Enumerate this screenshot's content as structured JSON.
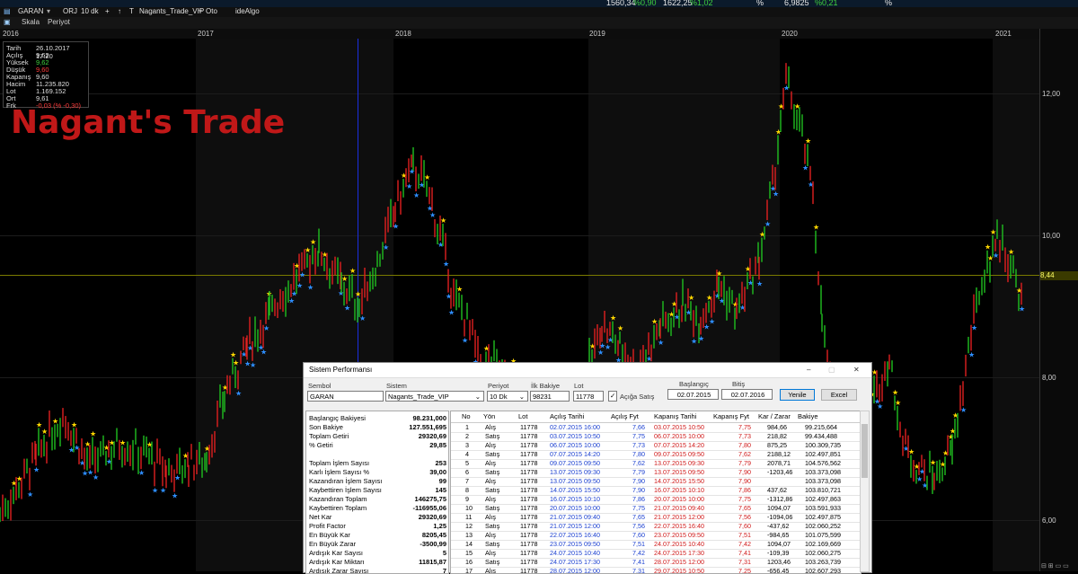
{
  "topbar": {
    "items": [
      "1560,34",
      "%0,90",
      "1622,25",
      "%1,02",
      "%",
      "6,9825",
      "%0,21",
      "%"
    ],
    "colors": {
      "up": "#3fd13f",
      "text": "#e8e8e8"
    }
  },
  "toolbar": {
    "symbol": "GARAN",
    "orj": "ORJ",
    "period": "10 dk",
    "system": "Nagants_Trade_VIP",
    "oto": "Oto",
    "idealgo": "ideAlgo"
  },
  "toolbar2": {
    "skala": "Skala",
    "periyot": "Periyot",
    "icons": [
      "arrow-left-icon",
      "arrow-right-icon",
      "shrink-icon",
      "expand-icon",
      "step-back-icon",
      "step-forward-icon",
      "cursor-icon",
      "crosshair-icon",
      "line-icon",
      "equal-icon",
      "zoom-out-icon",
      "zoom-in-icon",
      "zoom-fit-icon",
      "refresh-icon"
    ],
    "glyphs": [
      "◂",
      "▸",
      "▸◂",
      "◂▸",
      "◂|",
      "|▸",
      "↖",
      "⊹",
      "↗",
      "⇉",
      "⊖",
      "⊕",
      "⊙",
      "↺"
    ]
  },
  "years": [
    "2016",
    "2017",
    "2018",
    "2019",
    "2020",
    "2021"
  ],
  "yaxis": {
    "ticks": [
      "12,00",
      "10,00",
      "8,00",
      "6,00"
    ],
    "current": "8,44"
  },
  "info": {
    "rows": [
      {
        "k": "Tarih",
        "v": "26.10.2017 17:20"
      },
      {
        "k": "Açılış",
        "v": "9,62"
      },
      {
        "k": "Yüksek",
        "v": "9,62"
      },
      {
        "k": "Düşük",
        "v": "9,60"
      },
      {
        "k": "Kapanış",
        "v": "9,60"
      },
      {
        "k": "Hacim",
        "v": "11.235.820"
      },
      {
        "k": "Lot",
        "v": "1.169.152"
      },
      {
        "k": "Ort",
        "v": "9,61"
      },
      {
        "k": "Frk",
        "v": "-0,03 (% -0,30)"
      }
    ],
    "colors": {
      "Yüksek": "#3fd13f",
      "Düşük": "#ff3b3b",
      "Frk": "#ff3b3b"
    }
  },
  "watermark": "Nagant's Trade",
  "chart_data": {
    "type": "candlestick",
    "symbol": "GARAN",
    "x_range": [
      "2016",
      "2021"
    ],
    "ylim": [
      5.5,
      12.9
    ],
    "current_price": 8.44,
    "series_points": [
      [
        0,
        6.2
      ],
      [
        40,
        7.0
      ],
      [
        70,
        7.6
      ],
      [
        100,
        6.9
      ],
      [
        130,
        7.2
      ],
      [
        160,
        7.1
      ],
      [
        185,
        6.8
      ],
      [
        210,
        6.9
      ],
      [
        230,
        7.0
      ],
      [
        250,
        7.9
      ],
      [
        275,
        8.6
      ],
      [
        300,
        9.1
      ],
      [
        330,
        9.6
      ],
      [
        355,
        10.0
      ],
      [
        380,
        9.5
      ],
      [
        400,
        9.2
      ],
      [
        420,
        9.8
      ],
      [
        440,
        10.6
      ],
      [
        460,
        11.2
      ],
      [
        475,
        10.9
      ],
      [
        490,
        10.2
      ],
      [
        505,
        9.3
      ],
      [
        520,
        9.0
      ],
      [
        535,
        8.3
      ],
      [
        550,
        8.4
      ],
      [
        575,
        8.0
      ],
      [
        600,
        7.9
      ],
      [
        625,
        7.8
      ],
      [
        650,
        8.1
      ],
      [
        670,
        8.9
      ],
      [
        690,
        8.6
      ],
      [
        710,
        8.3
      ],
      [
        735,
        8.9
      ],
      [
        760,
        9.2
      ],
      [
        780,
        9.0
      ],
      [
        800,
        9.5
      ],
      [
        820,
        9.1
      ],
      [
        845,
        9.8
      ],
      [
        860,
        10.9
      ],
      [
        875,
        12.4
      ],
      [
        890,
        11.8
      ],
      [
        905,
        10.8
      ],
      [
        915,
        9.0
      ],
      [
        930,
        7.4
      ],
      [
        950,
        7.9
      ],
      [
        970,
        7.8
      ],
      [
        990,
        8.4
      ],
      [
        1005,
        7.2
      ],
      [
        1020,
        6.9
      ],
      [
        1040,
        6.7
      ],
      [
        1060,
        7.1
      ],
      [
        1075,
        8.3
      ],
      [
        1090,
        9.4
      ],
      [
        1110,
        10.2
      ],
      [
        1125,
        9.8
      ],
      [
        1140,
        9.1
      ]
    ]
  },
  "dialog": {
    "title": "Sistem Performansı",
    "labels": {
      "sembol": "Sembol",
      "sistem": "Sistem",
      "periyot": "Periyot",
      "ilk_bakiye": "İlk Bakiye",
      "lot": "Lot",
      "baslangic": "Başlangıç",
      "bitis": "Bitiş",
      "aciga_satis": "Açığa Satış"
    },
    "values": {
      "sembol": "GARAN",
      "sistem": "Nagants_Trade_VIP",
      "periyot": "10 Dk",
      "ilk_bakiye": "98231",
      "lot": "11778",
      "baslangic": "02.07.2015",
      "bitis": "02.07.2016"
    },
    "buttons": {
      "yenile": "Yenile",
      "excel": "Excel"
    },
    "stats": [
      {
        "k": "Başlangıç Bakiyesi",
        "v": "98.231,000"
      },
      {
        "k": "Son Bakiye",
        "v": "127.551,695"
      },
      {
        "k": "Toplam Getiri",
        "v": "29320,69"
      },
      {
        "k": "% Getiri",
        "v": "29,85"
      },
      {
        "k": "",
        "v": ""
      },
      {
        "k": "Toplam İşlem Sayısı",
        "v": "253"
      },
      {
        "k": "Karlı İşlem Sayısı %",
        "v": "39,00"
      },
      {
        "k": "Kazandıran İşlem Sayısı",
        "v": "99"
      },
      {
        "k": "Kaybettiren İşlem Sayısı",
        "v": "145"
      },
      {
        "k": "Kazandıran Toplam",
        "v": "146275,75"
      },
      {
        "k": "Kaybettiren Toplam",
        "v": "-116955,06"
      },
      {
        "k": "Net Kar",
        "v": "29320,69"
      },
      {
        "k": "Profit Factor",
        "v": "1,25"
      },
      {
        "k": "En Büyük Kar",
        "v": "8205,45"
      },
      {
        "k": "En Büyük Zarar",
        "v": "-3500,99"
      },
      {
        "k": "Ardışık Kar Sayısı",
        "v": "5"
      },
      {
        "k": "Ardışık Kar Miktarı",
        "v": "11815,87"
      },
      {
        "k": "Ardışık Zarar Sayısı",
        "v": "7"
      }
    ],
    "columns": [
      "No",
      "Yön",
      "Lot",
      "Açılış Tarihi",
      "Açılış Fyt",
      "Kapanış Tarihi",
      "Kapanış Fyt",
      "Kar / Zarar",
      "Bakiye"
    ],
    "trades": [
      {
        "no": "1",
        "yon": "Alış",
        "lot": "11778",
        "acilis_tarihi": "02.07.2015 16:00",
        "acilis_fyt": "7,66",
        "kapanis_tarihi": "03.07.2015 10:50",
        "kapanis_fyt": "7,75",
        "kar": "984,66",
        "bakiye": "99.215,664"
      },
      {
        "no": "2",
        "yon": "Satış",
        "lot": "11778",
        "acilis_tarihi": "03.07.2015 10:50",
        "acilis_fyt": "7,75",
        "kapanis_tarihi": "06.07.2015 10:00",
        "kapanis_fyt": "7,73",
        "kar": "218,82",
        "bakiye": "99.434,488"
      },
      {
        "no": "3",
        "yon": "Alış",
        "lot": "11778",
        "acilis_tarihi": "06.07.2015 10:00",
        "acilis_fyt": "7,73",
        "kapanis_tarihi": "07.07.2015 14:20",
        "kapanis_fyt": "7,80",
        "kar": "875,25",
        "bakiye": "100.309,735"
      },
      {
        "no": "4",
        "yon": "Satış",
        "lot": "11778",
        "acilis_tarihi": "07.07.2015 14:20",
        "acilis_fyt": "7,80",
        "kapanis_tarihi": "09.07.2015 09:50",
        "kapanis_fyt": "7,62",
        "kar": "2188,12",
        "bakiye": "102.497,851"
      },
      {
        "no": "5",
        "yon": "Alış",
        "lot": "11778",
        "acilis_tarihi": "09.07.2015 09:50",
        "acilis_fyt": "7,62",
        "kapanis_tarihi": "13.07.2015 09:30",
        "kapanis_fyt": "7,79",
        "kar": "2078,71",
        "bakiye": "104.576,562"
      },
      {
        "no": "6",
        "yon": "Satış",
        "lot": "11778",
        "acilis_tarihi": "13.07.2015 09:30",
        "acilis_fyt": "7,79",
        "kapanis_tarihi": "13.07.2015 09:50",
        "kapanis_fyt": "7,90",
        "kar": "-1203,46",
        "bakiye": "103.373,098"
      },
      {
        "no": "7",
        "yon": "Alış",
        "lot": "11778",
        "acilis_tarihi": "13.07.2015 09:50",
        "acilis_fyt": "7,90",
        "kapanis_tarihi": "14.07.2015 15:50",
        "kapanis_fyt": "7,90",
        "kar": "",
        "bakiye": "103.373,098"
      },
      {
        "no": "8",
        "yon": "Satış",
        "lot": "11778",
        "acilis_tarihi": "14.07.2015 15:50",
        "acilis_fyt": "7,90",
        "kapanis_tarihi": "16.07.2015 10:10",
        "kapanis_fyt": "7,86",
        "kar": "437,62",
        "bakiye": "103.810,721"
      },
      {
        "no": "9",
        "yon": "Alış",
        "lot": "11778",
        "acilis_tarihi": "16.07.2015 10:10",
        "acilis_fyt": "7,86",
        "kapanis_tarihi": "20.07.2015 10:00",
        "kapanis_fyt": "7,75",
        "kar": "-1312,86",
        "bakiye": "102.497,863"
      },
      {
        "no": "10",
        "yon": "Satış",
        "lot": "11778",
        "acilis_tarihi": "20.07.2015 10:00",
        "acilis_fyt": "7,75",
        "kapanis_tarihi": "21.07.2015 09:40",
        "kapanis_fyt": "7,65",
        "kar": "1094,07",
        "bakiye": "103.591,933"
      },
      {
        "no": "11",
        "yon": "Alış",
        "lot": "11778",
        "acilis_tarihi": "21.07.2015 09:40",
        "acilis_fyt": "7,65",
        "kapanis_tarihi": "21.07.2015 12:00",
        "kapanis_fyt": "7,56",
        "kar": "-1094,06",
        "bakiye": "102.497,875"
      },
      {
        "no": "12",
        "yon": "Satış",
        "lot": "11778",
        "acilis_tarihi": "21.07.2015 12:00",
        "acilis_fyt": "7,56",
        "kapanis_tarihi": "22.07.2015 16:40",
        "kapanis_fyt": "7,60",
        "kar": "-437,62",
        "bakiye": "102.060,252"
      },
      {
        "no": "13",
        "yon": "Alış",
        "lot": "11778",
        "acilis_tarihi": "22.07.2015 16:40",
        "acilis_fyt": "7,60",
        "kapanis_tarihi": "23.07.2015 09:50",
        "kapanis_fyt": "7,51",
        "kar": "-984,65",
        "bakiye": "101.075,599"
      },
      {
        "no": "14",
        "yon": "Satış",
        "lot": "11778",
        "acilis_tarihi": "23.07.2015 09:50",
        "acilis_fyt": "7,51",
        "kapanis_tarihi": "24.07.2015 10:40",
        "kapanis_fyt": "7,42",
        "kar": "1094,07",
        "bakiye": "102.169,669"
      },
      {
        "no": "15",
        "yon": "Alış",
        "lot": "11778",
        "acilis_tarihi": "24.07.2015 10:40",
        "acilis_fyt": "7,42",
        "kapanis_tarihi": "24.07.2015 17:30",
        "kapanis_fyt": "7,41",
        "kar": "-109,39",
        "bakiye": "102.060,275"
      },
      {
        "no": "16",
        "yon": "Satış",
        "lot": "11778",
        "acilis_tarihi": "24.07.2015 17:30",
        "acilis_fyt": "7,41",
        "kapanis_tarihi": "28.07.2015 12:00",
        "kapanis_fyt": "7,31",
        "kar": "1203,46",
        "bakiye": "103.263,739"
      },
      {
        "no": "17",
        "yon": "Alış",
        "lot": "11778",
        "acilis_tarihi": "28.07.2015 12:00",
        "acilis_fyt": "7,31",
        "kapanis_tarihi": "29.07.2015 10:50",
        "kapanis_fyt": "7,25",
        "kar": "-656,45",
        "bakiye": "102.607,293"
      }
    ],
    "colors": {
      "open_date": "#1a3fd0",
      "close_date": "#d01a1a"
    }
  }
}
